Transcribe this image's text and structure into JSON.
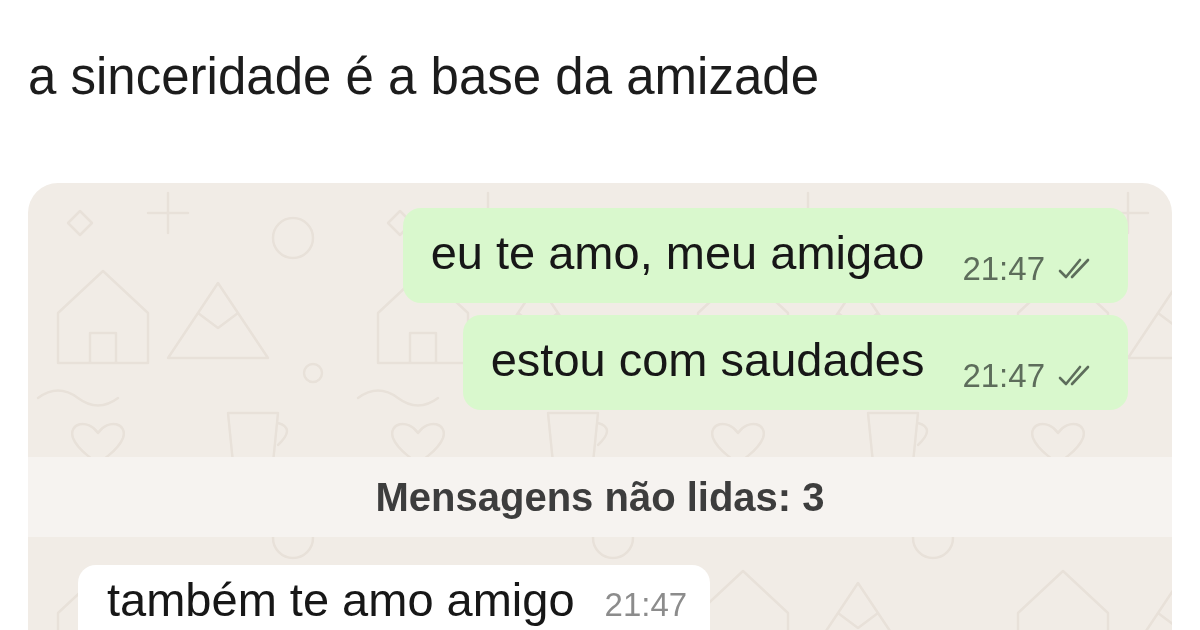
{
  "caption": "a sinceridade é a base da amizade",
  "chat": {
    "items": [
      {
        "kind": "outgoing",
        "text": "eu te amo, meu amigao",
        "time": "21:47",
        "read": false
      },
      {
        "kind": "outgoing",
        "text": "estou com saudades",
        "time": "21:47",
        "read": false
      },
      {
        "kind": "unread_divider",
        "text": "Mensagens não lidas: 3"
      },
      {
        "kind": "incoming",
        "text": "também te amo amigo",
        "time": "21:47"
      }
    ]
  }
}
